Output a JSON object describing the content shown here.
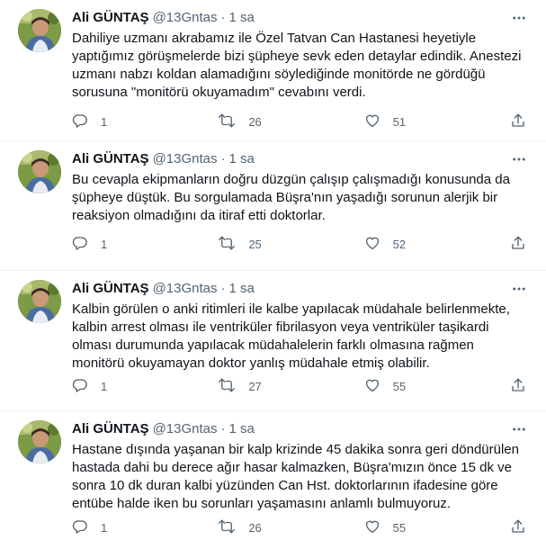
{
  "tweets": [
    {
      "author": "Ali GÜNTAŞ",
      "handle": "@13Gntas",
      "separator": "·",
      "time": "1 sa",
      "text": "Dahiliye uzmanı akrabamız ile Özel Tatvan Can Hastanesi heyetiyle\nyaptığımız görüşmelerde bizi şüpheye sevk eden detaylar edindik. Anestezi\nuzmanı nabzı koldan alamadığını söylediğinde monitörde ne gördüğü\nsorusuna \"monitörü okuyamadım\" cevabını verdi.",
      "replies": "1",
      "retweets": "26",
      "likes": "51"
    },
    {
      "author": "Ali GÜNTAŞ",
      "handle": "@13Gntas",
      "separator": "·",
      "time": "1 sa",
      "text": "Bu cevapla ekipmanların doğru düzgün çalışıp çalışmadığı konusunda da\nşüpheye düştük. Bu sorgulamada Büşra'nın yaşadığı sorunun alerjik bir\nreaksiyon olmadığını da itiraf etti doktorlar.",
      "replies": "1",
      "retweets": "25",
      "likes": "52"
    },
    {
      "author": "Ali GÜNTAŞ",
      "handle": "@13Gntas",
      "separator": "·",
      "time": "1 sa",
      "text": "Kalbin görülen o anki ritimleri ile kalbe yapılacak müdahale belirlenmekte,\nkalbin arrest olması ile ventriküler fibrilasyon veya ventriküler taşikardi\nolması durumunda yapılacak müdahalelerin farklı olmasına rağmen\nmonitörü okuyamayan doktor yanlış müdahale etmiş olabilir.",
      "replies": "1",
      "retweets": "27",
      "likes": "55"
    },
    {
      "author": "Ali GÜNTAŞ",
      "handle": "@13Gntas",
      "separator": "·",
      "time": "1 sa",
      "text": "Hastane dışında yaşanan bir kalp krizinde 45 dakika sonra geri döndürülen\nhastada dahi bu derece ağır hasar kalmazken, Büşra'mızın önce 15 dk ve\nsonra 10 dk duran kalbi yüzünden Can Hst. doktorlarının ifadesine göre\nentübe halde iken bu sorunları yaşamasını anlamlı bulmuyoruz.",
      "replies": "1",
      "retweets": "26",
      "likes": "55"
    }
  ],
  "icons": {
    "more": "more-dots-icon",
    "reply": "reply-icon",
    "retweet": "retweet-icon",
    "like": "heart-icon",
    "share": "share-icon"
  },
  "colors": {
    "text": "#0f1419",
    "secondary": "#536471",
    "divider": "#eff3f4"
  }
}
